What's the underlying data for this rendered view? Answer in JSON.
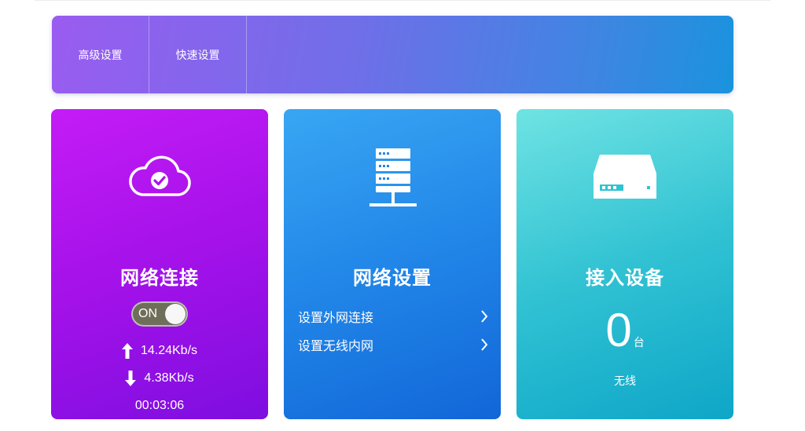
{
  "nav": {
    "tabs": [
      {
        "label": "高级设置"
      },
      {
        "label": "快速设置"
      }
    ]
  },
  "cards": {
    "network": {
      "title": "网络连接",
      "toggle_label": "ON",
      "upload_rate": "14.24Kb/s",
      "download_rate": "4.38Kb/s",
      "uptime": "00:03:06",
      "icon": "cloud-check-icon"
    },
    "settings": {
      "title": "网络设置",
      "icon": "server-icon",
      "links": [
        {
          "label": "设置外网连接"
        },
        {
          "label": "设置无线内网"
        }
      ]
    },
    "devices": {
      "title": "接入设备",
      "icon": "router-icon",
      "count": "0",
      "unit": "台",
      "subtitle": "无线"
    }
  },
  "colors": {
    "card_purple": "#a712ea",
    "card_blue": "#2186e8",
    "card_teal": "#31c2d3"
  }
}
